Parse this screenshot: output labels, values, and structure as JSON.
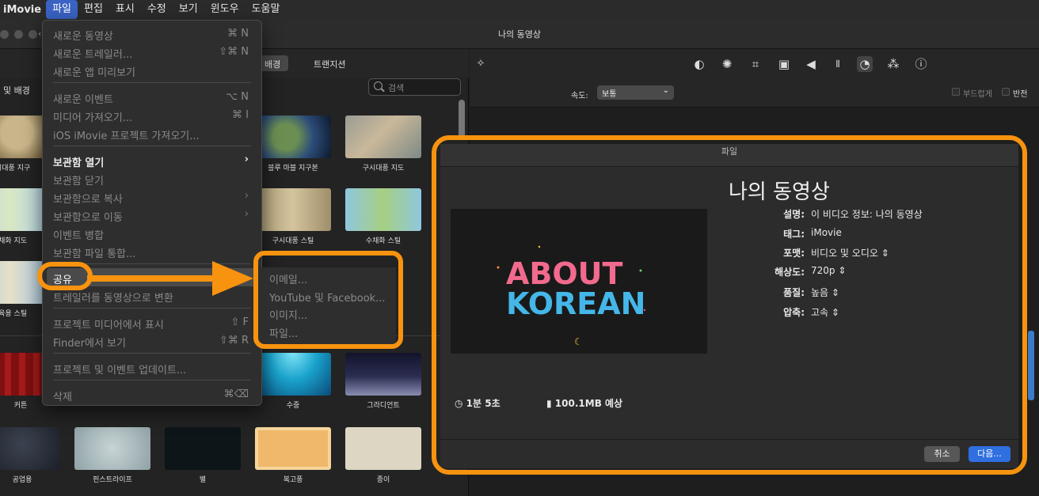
{
  "menubar": {
    "app": "iMovie",
    "items": [
      "파일",
      "편집",
      "표시",
      "수정",
      "보기",
      "윈도우",
      "도움말"
    ]
  },
  "window": {
    "title": "나의 동영상"
  },
  "browser": {
    "tabs": {
      "backgrounds": "배경",
      "transitions": "트랜지션"
    },
    "section_label": "및 배경",
    "search_placeholder": "검색",
    "maps": [
      {
        "label": "구시대풍 지구"
      },
      {
        "label": "블루 마블 지구본"
      },
      {
        "label": "구시대풍 지도"
      },
      {
        "label": "수채화 지도"
      },
      {
        "label": "구시대풍 스틸"
      },
      {
        "label": "수채화 스틸"
      },
      {
        "label": "교육용 스틸"
      }
    ],
    "backgrounds": [
      {
        "label": "커튼"
      },
      {
        "label": "수중"
      },
      {
        "label": "그라디언트"
      },
      {
        "label": "공업용"
      },
      {
        "label": "핀스트라이프"
      },
      {
        "label": "별"
      },
      {
        "label": "복고풍"
      },
      {
        "label": "종이"
      }
    ]
  },
  "viewer": {
    "speed_label": "속도:",
    "speed_value": "보통",
    "smooth_label": "부드럽게",
    "reverse_label": "반전"
  },
  "file_menu": {
    "new_movie": "새로운 동영상",
    "new_movie_sc": "⌘ N",
    "new_trailer": "새로운 트레일러...",
    "new_trailer_sc": "⇧⌘ N",
    "new_app_preview": "새로운 앱 미리보기",
    "new_event": "새로운 이벤트",
    "new_event_sc": "⌥ N",
    "import_media": "미디어 가져오기...",
    "import_media_sc": "⌘ I",
    "import_ios": "iOS iMovie 프로젝트 가져오기...",
    "open_library": "보관함 열기",
    "close_library": "보관함 닫기",
    "copy_library": "보관함으로 복사",
    "move_library": "보관함으로 이동",
    "merge_events": "이벤트 병합",
    "consolidate": "보관함 파일 통합...",
    "share": "공유",
    "convert_trailer": "트레일러를 동영상으로 변환",
    "reveal_project": "프로젝트 미디어에서 표시",
    "reveal_project_sc": "⇧ F",
    "reveal_finder": "Finder에서 보기",
    "reveal_finder_sc": "⇧⌘ R",
    "update": "프로젝트 및 이벤트 업데이트...",
    "delete": "삭제",
    "delete_sc": "⌘⌫"
  },
  "share_submenu": {
    "email": "이메일...",
    "youtube": "YouTube 및 Facebook...",
    "image": "이미지...",
    "file": "파일..."
  },
  "dialog": {
    "window_title": "파일",
    "title": "나의 동영상",
    "preview_text_line1": "ABOUT",
    "preview_text_line2": "KOREAN",
    "fields": {
      "description_label": "설명:",
      "description_value": "이 비디오 정보: 나의 동영상",
      "tags_label": "태그:",
      "tags_value": "iMovie",
      "format_label": "포맷:",
      "format_value": "비디오 및 오디오",
      "resolution_label": "해상도:",
      "resolution_value": "720p",
      "quality_label": "품질:",
      "quality_value": "높음",
      "compress_label": "압축:",
      "compress_value": "고속"
    },
    "duration": "1분 5초",
    "size": "100.1MB 예상",
    "cancel": "취소",
    "next": "다음..."
  },
  "colors": {
    "annotation": "#f7930f",
    "accent_blue": "#2f6fe0",
    "menu_highlight": "#3a63c4"
  }
}
